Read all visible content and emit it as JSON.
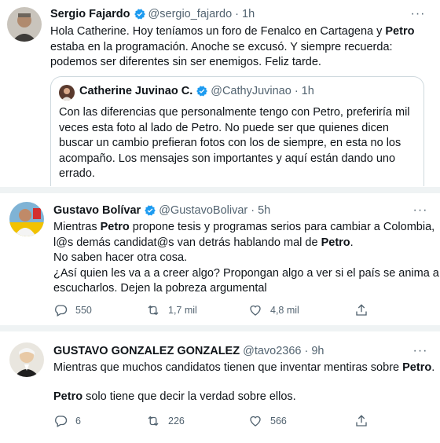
{
  "tweets": [
    {
      "name": "Sergio Fajardo",
      "handle": "@sergio_fajardo",
      "dot": "·",
      "time": "1h",
      "text": [
        [
          "Hola Catherine. Hoy teníamos un foro de Fenalco en Cartagena y ",
          "Petro"
        ],
        [
          "estaba en la programación. Anoche se excusó. Y siempre recuerda:"
        ],
        [
          "podemos ser diferentes sin ser enemigos. Feliz tarde."
        ]
      ],
      "quote": {
        "name": "Catherine Juvinao C.",
        "handle": "@CathyJuvinao",
        "dot": "·",
        "time": "1h",
        "text": [
          "Con las diferencias que personalmente tengo con Petro, preferiría mil",
          "veces esta foto al lado de Petro. No puede ser que quienes dicen",
          "buscar un cambio prefieran fotos con los de siempre, en esta no los",
          "acompaño. Los mensajes son importantes y aquí están dando uno",
          "errado."
        ]
      }
    },
    {
      "name": "Gustavo Bolívar",
      "handle": "@GustavoBolivar",
      "dot": "·",
      "time": "5h",
      "text": [
        [
          "Mientras ",
          "Petro",
          " propone tesis y programas serios para cambiar a Colombia,"
        ],
        [
          "l@s demás candidat@s van detrás hablando mal de ",
          "Petro",
          "."
        ],
        [
          "No saben hacer otra cosa."
        ],
        [
          "¿Así quien les va a a creer algo? Propongan algo a ver si el país se anima a"
        ],
        [
          "escucharlos. Dejen la pobreza argumental"
        ]
      ],
      "replies": "550",
      "retweets": "1,7 mil",
      "likes": "4,8 mil"
    },
    {
      "name": "GUSTAVO GONZALEZ GONZALEZ",
      "handle": "@tavo2366",
      "dot": "·",
      "time": "9h",
      "text": [
        [
          "Mientras que muchos candidatos tienen que inventar mentiras sobre ",
          "Petro",
          "."
        ],
        [
          ""
        ],
        [
          "",
          "Petro",
          " solo tiene que decir la verdad sobre ellos."
        ]
      ],
      "replies": "6",
      "retweets": "226",
      "likes": "566"
    }
  ],
  "more_label": "···",
  "colors": {
    "text": "#0f1419",
    "muted": "#536471",
    "verified": "#1d9bf0",
    "border": "#cfd9de",
    "separator": "#eff3f4"
  },
  "icons": [
    "verified-badge-icon",
    "more-icon",
    "reply-icon",
    "retweet-icon",
    "like-icon",
    "share-icon"
  ]
}
